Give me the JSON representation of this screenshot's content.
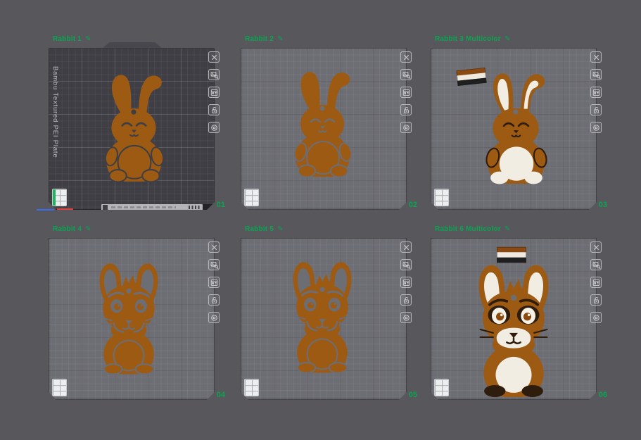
{
  "ui": {
    "edit_glyph": "✎",
    "accent_green": "#0aa551"
  },
  "plates": [
    {
      "label": "Rabbit 1",
      "number": "01"
    },
    {
      "label": "Rabbit 2",
      "number": "02"
    },
    {
      "label": "Rabbit 3 Multicolor",
      "number": "03"
    },
    {
      "label": "Rabbit 4",
      "number": "04"
    },
    {
      "label": "Rabbit 5",
      "number": "05"
    },
    {
      "label": "Rabbit 6 Multicolor",
      "number": "06"
    }
  ],
  "plate1": {
    "texture_text": "Bambu Textured PEI Plate"
  },
  "plate_toolbar_icons": [
    "delete-plate",
    "plate-preview",
    "plate-settings",
    "lock-plate",
    "filament-mapping"
  ],
  "colors": {
    "rabbit_brown": "#9d5a13",
    "plate_gray": "#6d6d74",
    "textured_plate": "#3e3e44",
    "filament": [
      "#8a4a12",
      "#efe9df",
      "#1f1f1f"
    ]
  }
}
